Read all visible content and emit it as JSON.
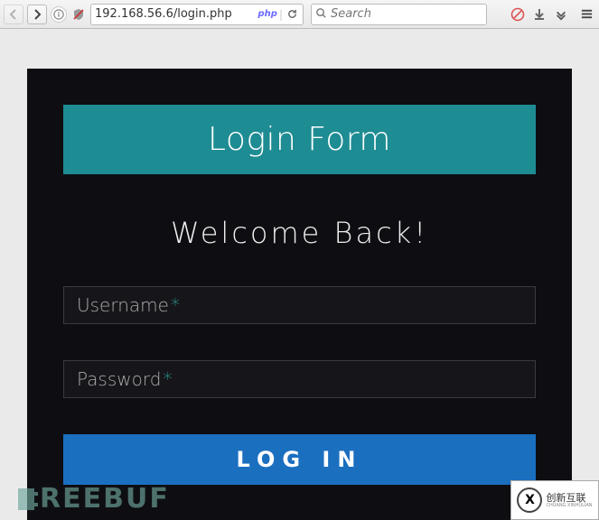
{
  "toolbar": {
    "url": "192.168.56.6/login.php",
    "url_badge": "php",
    "search_placeholder": "Search"
  },
  "login": {
    "title": "Login Form",
    "welcome": "Welcome Back!",
    "username_label": "Username",
    "password_label": "Password",
    "required_marker": "*",
    "submit_label": "LOG IN"
  },
  "watermarks": {
    "left_text": "REEBUF",
    "right_text": "创新互联",
    "right_sub": "CHUANG XINHULIAN",
    "right_badge": "X"
  },
  "colors": {
    "card_bg": "#0e0e12",
    "header_bg": "#1e8c93",
    "button_bg": "#1b6fbf",
    "accent": "#31a8a0"
  }
}
